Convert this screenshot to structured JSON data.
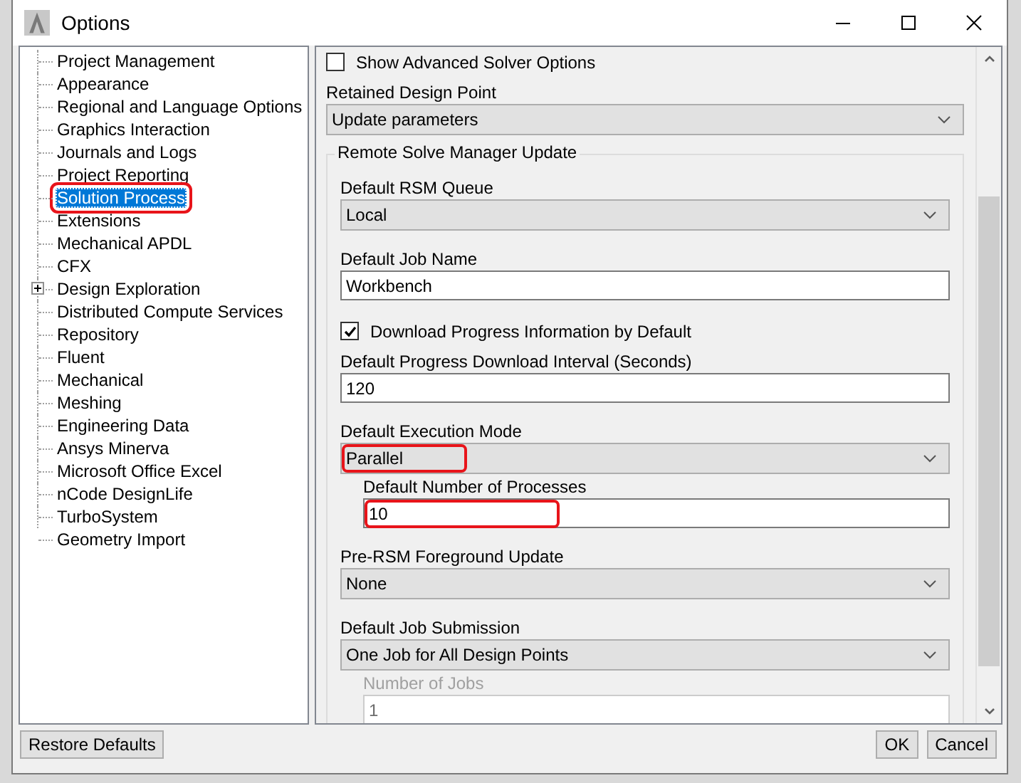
{
  "window": {
    "title": "Options"
  },
  "tree": [
    {
      "label": "Project Management",
      "selected": false,
      "annotated": false
    },
    {
      "label": "Appearance",
      "selected": false,
      "annotated": false
    },
    {
      "label": "Regional and Language Options",
      "selected": false,
      "annotated": false
    },
    {
      "label": "Graphics Interaction",
      "selected": false,
      "annotated": false
    },
    {
      "label": "Journals and Logs",
      "selected": false,
      "annotated": false
    },
    {
      "label": "Project Reporting",
      "selected": false,
      "annotated": false
    },
    {
      "label": "Solution Process",
      "selected": true,
      "annotated": true
    },
    {
      "label": "Extensions",
      "selected": false,
      "annotated": false
    },
    {
      "label": "Mechanical APDL",
      "selected": false,
      "annotated": false
    },
    {
      "label": "CFX",
      "selected": false,
      "annotated": false
    },
    {
      "label": "Design Exploration",
      "selected": false,
      "annotated": false,
      "expanded": false
    },
    {
      "label": "Distributed Compute Services",
      "selected": false,
      "annotated": false
    },
    {
      "label": "Repository",
      "selected": false,
      "annotated": false
    },
    {
      "label": "Fluent",
      "selected": false,
      "annotated": false
    },
    {
      "label": "Mechanical",
      "selected": false,
      "annotated": false
    },
    {
      "label": "Meshing",
      "selected": false,
      "annotated": false
    },
    {
      "label": "Engineering Data",
      "selected": false,
      "annotated": false
    },
    {
      "label": "Ansys Minerva",
      "selected": false,
      "annotated": false
    },
    {
      "label": "Microsoft Office Excel",
      "selected": false,
      "annotated": false
    },
    {
      "label": "nCode DesignLife",
      "selected": false,
      "annotated": false
    },
    {
      "label": "TurboSystem",
      "selected": false,
      "annotated": false
    },
    {
      "label": "Geometry Import",
      "selected": false,
      "annotated": false
    }
  ],
  "settings": [
    {
      "kind": "checkbox",
      "label": "Show Advanced Solver Options",
      "checked": false
    },
    {
      "kind": "dropdown",
      "label": "Retained Design Point",
      "value": "Update parameters"
    }
  ],
  "group": {
    "title": "Remote Solve Manager Update",
    "fields": [
      {
        "kind": "dropdown",
        "label": "Default RSM Queue",
        "value": "Local",
        "annotated": false
      },
      {
        "kind": "text",
        "label": "Default Job Name",
        "value": "Workbench",
        "annotated": false
      },
      {
        "kind": "checkbox",
        "label": "Download Progress Information by Default",
        "checked": true
      },
      {
        "kind": "text",
        "label": "Default Progress Download Interval (Seconds)",
        "value": "120",
        "annotated": false
      },
      {
        "kind": "dropdown",
        "label": "Default Execution Mode",
        "value": "Parallel",
        "annotated": true,
        "children": [
          {
            "kind": "text",
            "label": "Default Number of Processes",
            "value": "10",
            "annotated": true,
            "disabled": false
          }
        ]
      },
      {
        "kind": "dropdown",
        "label": "Pre-RSM Foreground Update",
        "value": "None",
        "annotated": false
      },
      {
        "kind": "dropdown",
        "label": "Default Job Submission",
        "value": "One Job for All Design Points",
        "annotated": false,
        "children": [
          {
            "kind": "text",
            "label": "Number of Jobs",
            "value": "1",
            "annotated": false,
            "disabled": true
          }
        ]
      }
    ]
  },
  "buttons": {
    "restore": "Restore Defaults",
    "ok": "OK",
    "cancel": "Cancel"
  }
}
